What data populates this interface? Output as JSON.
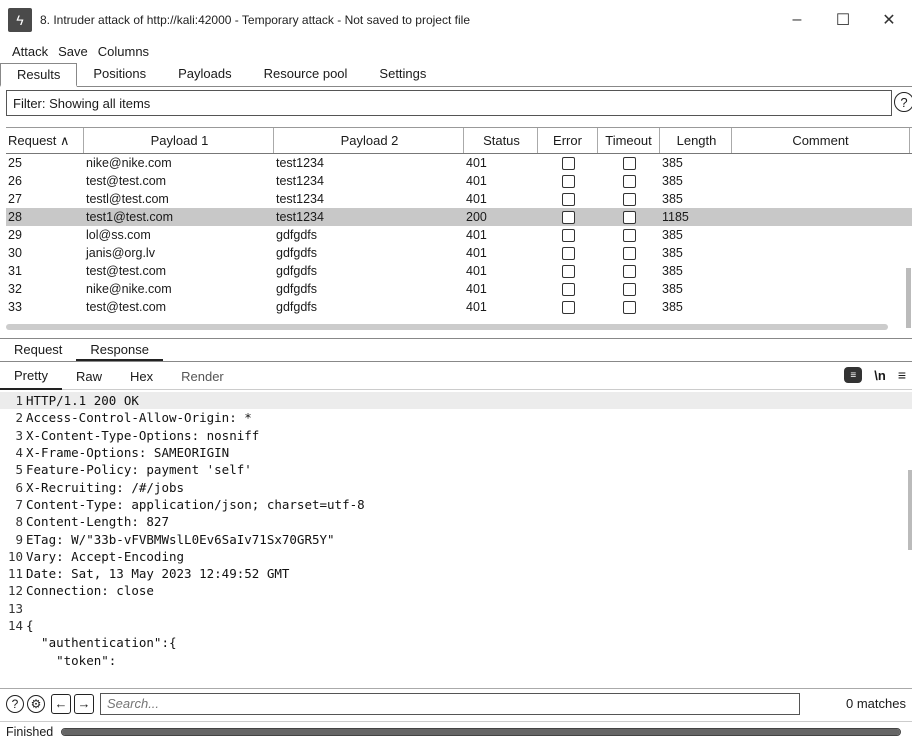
{
  "window": {
    "title": "8. Intruder attack of http://kali:42000 - Temporary attack - Not saved to project file",
    "minimize": "–",
    "maximize": "☐",
    "close": "✕"
  },
  "menu": [
    "Attack",
    "Save",
    "Columns"
  ],
  "main_tabs": [
    "Results",
    "Positions",
    "Payloads",
    "Resource pool",
    "Settings"
  ],
  "filter": {
    "text": "Filter: Showing all items",
    "help": "?"
  },
  "table": {
    "columns": [
      "Request ∧",
      "Payload 1",
      "Payload 2",
      "Status",
      "Error",
      "Timeout",
      "Length",
      "Comment"
    ],
    "rows": [
      {
        "req": "25",
        "p1": "nike@nike.com",
        "p2": "test1234",
        "status": "401",
        "length": "385",
        "selected": false
      },
      {
        "req": "26",
        "p1": "test@test.com",
        "p2": "test1234",
        "status": "401",
        "length": "385",
        "selected": false
      },
      {
        "req": "27",
        "p1": "testl@test.com",
        "p2": "test1234",
        "status": "401",
        "length": "385",
        "selected": false
      },
      {
        "req": "28",
        "p1": "test1@test.com",
        "p2": "test1234",
        "status": "200",
        "length": "1185",
        "selected": true
      },
      {
        "req": "29",
        "p1": "lol@ss.com",
        "p2": "gdfgdfs",
        "status": "401",
        "length": "385",
        "selected": false
      },
      {
        "req": "30",
        "p1": "janis@org.lv",
        "p2": "gdfgdfs",
        "status": "401",
        "length": "385",
        "selected": false
      },
      {
        "req": "31",
        "p1": "test@test.com",
        "p2": "gdfgdfs",
        "status": "401",
        "length": "385",
        "selected": false
      },
      {
        "req": "32",
        "p1": "nike@nike.com",
        "p2": "gdfgdfs",
        "status": "401",
        "length": "385",
        "selected": false
      },
      {
        "req": "33",
        "p1": "test@test.com",
        "p2": "gdfgdfs",
        "status": "401",
        "length": "385",
        "selected": false
      }
    ]
  },
  "sub_tabs": [
    "Request",
    "Response"
  ],
  "view_tabs": [
    "Pretty",
    "Raw",
    "Hex",
    "Render"
  ],
  "view_icons": {
    "message": "≡",
    "newline": "\\n",
    "menu": "≡"
  },
  "code_lines": [
    {
      "n": "1",
      "text": "HTTP/1.1 200 OK"
    },
    {
      "n": "2",
      "text": "Access-Control-Allow-Origin: *"
    },
    {
      "n": "3",
      "text": "X-Content-Type-Options: nosniff"
    },
    {
      "n": "4",
      "text": "X-Frame-Options: SAMEORIGIN"
    },
    {
      "n": "5",
      "text": "Feature-Policy: payment 'self'"
    },
    {
      "n": "6",
      "text": "X-Recruiting: /#/jobs"
    },
    {
      "n": "7",
      "text": "Content-Type: application/json; charset=utf-8"
    },
    {
      "n": "8",
      "text": "Content-Length: 827"
    },
    {
      "n": "9",
      "text": "ETag: W/\"33b-vFVBMWslL0Ev6SaIv71Sx70GR5Y\""
    },
    {
      "n": "10",
      "text": "Vary: Accept-Encoding"
    },
    {
      "n": "11",
      "text": "Date: Sat, 13 May 2023 12:49:52 GMT"
    },
    {
      "n": "12",
      "text": "Connection: close"
    },
    {
      "n": "13",
      "text": ""
    },
    {
      "n": "14",
      "text": "{"
    },
    {
      "n": "",
      "text": "  \"authentication\":{"
    },
    {
      "n": "",
      "text": "    \"token\":"
    }
  ],
  "search": {
    "placeholder": "Search...",
    "matches": "0 matches"
  },
  "status": {
    "text": "Finished",
    "progress": 1.0
  }
}
